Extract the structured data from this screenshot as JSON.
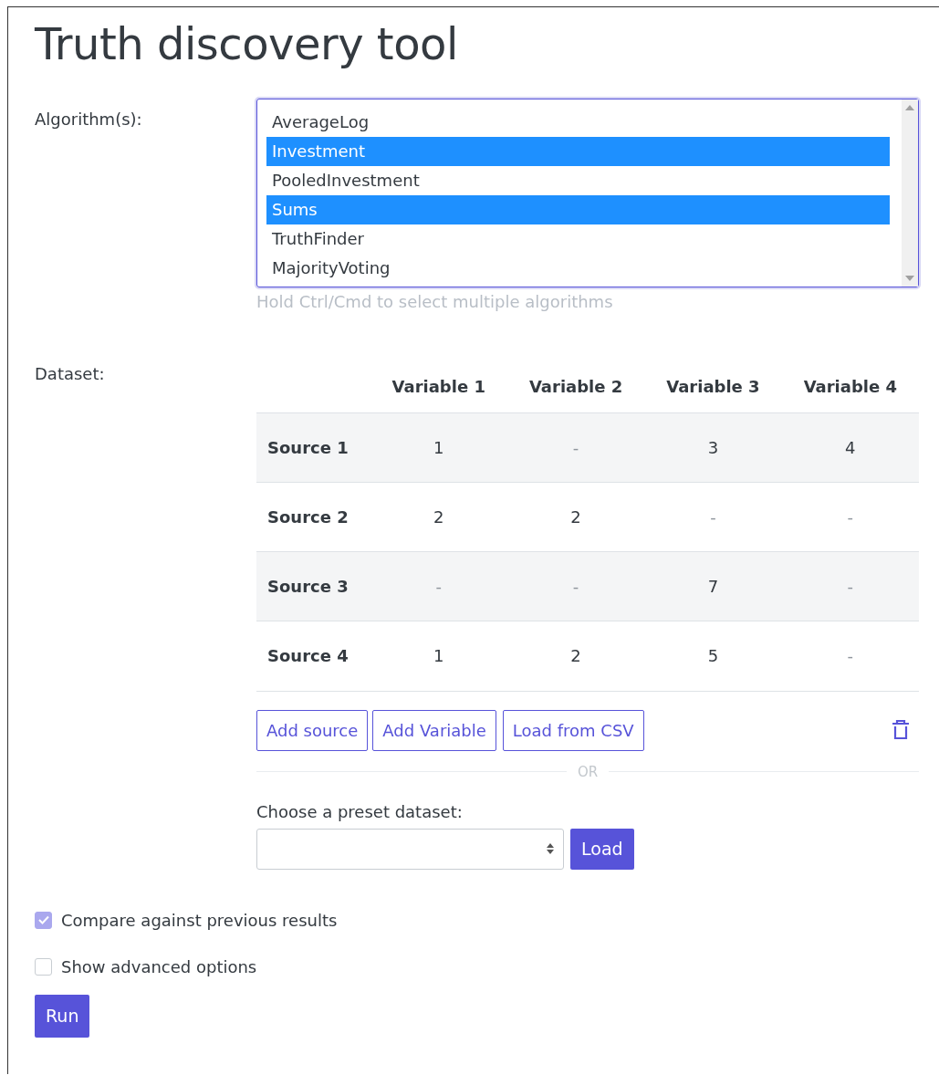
{
  "title": "Truth discovery tool",
  "algorithms": {
    "label": "Algorithm(s):",
    "options": [
      {
        "label": "AverageLog",
        "selected": false
      },
      {
        "label": "Investment",
        "selected": true
      },
      {
        "label": "PooledInvestment",
        "selected": false
      },
      {
        "label": "Sums",
        "selected": true
      },
      {
        "label": "TruthFinder",
        "selected": false
      },
      {
        "label": "MajorityVoting",
        "selected": false
      }
    ],
    "hint": "Hold Ctrl/Cmd to select multiple algorithms"
  },
  "dataset": {
    "label": "Dataset:",
    "columns": [
      "Variable 1",
      "Variable 2",
      "Variable 3",
      "Variable 4"
    ],
    "rows": [
      {
        "source": "Source 1",
        "cells": [
          {
            "value": "1",
            "missing": false
          },
          {
            "value": "-",
            "missing": true
          },
          {
            "value": "3",
            "missing": false
          },
          {
            "value": "4",
            "missing": false
          }
        ]
      },
      {
        "source": "Source 2",
        "cells": [
          {
            "value": "2",
            "missing": false
          },
          {
            "value": "2",
            "missing": false
          },
          {
            "value": "-",
            "missing": true
          },
          {
            "value": "-",
            "missing": true
          }
        ]
      },
      {
        "source": "Source 3",
        "cells": [
          {
            "value": "-",
            "missing": true
          },
          {
            "value": "-",
            "missing": true
          },
          {
            "value": "7",
            "missing": false
          },
          {
            "value": "-",
            "missing": true
          }
        ]
      },
      {
        "source": "Source 4",
        "cells": [
          {
            "value": "1",
            "missing": false
          },
          {
            "value": "2",
            "missing": false
          },
          {
            "value": "5",
            "missing": false
          },
          {
            "value": "-",
            "missing": true
          }
        ]
      }
    ],
    "buttons": [
      "Add source",
      "Add Variable",
      "Load from CSV"
    ],
    "divider": "OR",
    "preset_label": "Choose a preset dataset:",
    "load_button": "Load"
  },
  "options": [
    {
      "label": "Compare against previous results",
      "checked": true
    },
    {
      "label": "Show advanced options",
      "checked": false
    }
  ],
  "run_button": "Run"
}
